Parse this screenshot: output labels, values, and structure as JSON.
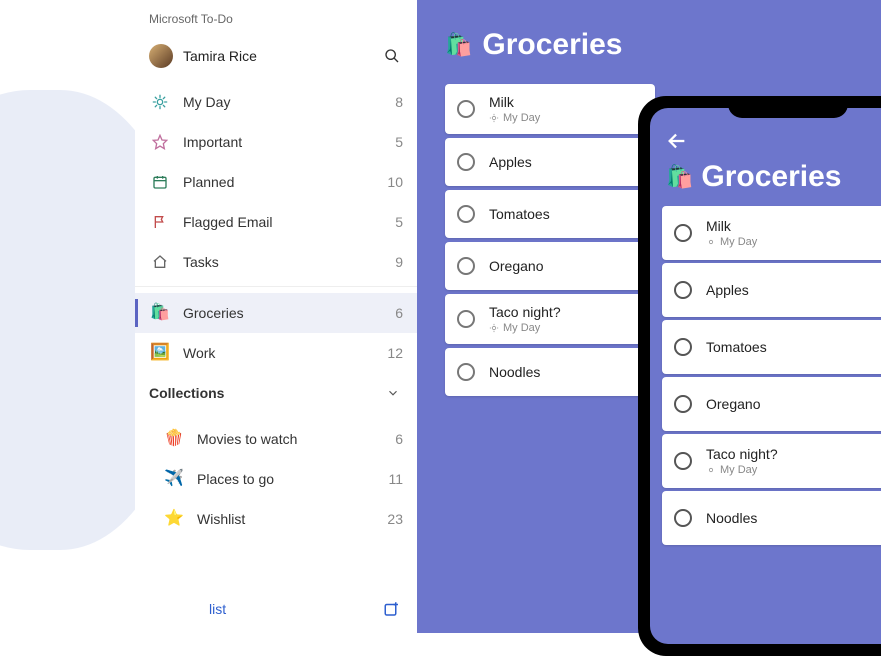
{
  "app": {
    "title": "Microsoft To-Do"
  },
  "profile": {
    "name": "Tamira Rice"
  },
  "sidebar": {
    "items": [
      {
        "label": "My Day",
        "count": "8",
        "icon": "sun-icon"
      },
      {
        "label": "Important",
        "count": "5",
        "icon": "star-icon"
      },
      {
        "label": "Planned",
        "count": "10",
        "icon": "calendar-icon"
      },
      {
        "label": "Flagged Email",
        "count": "5",
        "icon": "flag-icon"
      },
      {
        "label": "Tasks",
        "count": "9",
        "icon": "home-icon"
      }
    ],
    "lists": [
      {
        "label": "Groceries",
        "count": "6",
        "icon": "shopping-bag-icon",
        "active": true
      },
      {
        "label": "Work",
        "count": "12",
        "icon": "work-icon"
      }
    ],
    "collections_label": "Collections",
    "collections": [
      {
        "label": "Movies to watch",
        "count": "6",
        "icon": "popcorn-icon"
      },
      {
        "label": "Places to go",
        "count": "11",
        "icon": "airplane-icon"
      },
      {
        "label": "Wishlist",
        "count": "23",
        "icon": "wish-star-icon"
      }
    ],
    "new_list_label": "list"
  },
  "panel": {
    "title": "Groceries",
    "tasks": [
      {
        "title": "Milk",
        "sub": "My Day"
      },
      {
        "title": "Apples"
      },
      {
        "title": "Tomatoes"
      },
      {
        "title": "Oregano"
      },
      {
        "title": "Taco night?",
        "sub": "My Day"
      },
      {
        "title": "Noodles"
      }
    ]
  },
  "phone": {
    "title": "Groceries",
    "tasks": [
      {
        "title": "Milk",
        "sub": "My Day"
      },
      {
        "title": "Apples"
      },
      {
        "title": "Tomatoes"
      },
      {
        "title": "Oregano"
      },
      {
        "title": "Taco night?",
        "sub": "My Day"
      },
      {
        "title": "Noodles"
      }
    ]
  }
}
